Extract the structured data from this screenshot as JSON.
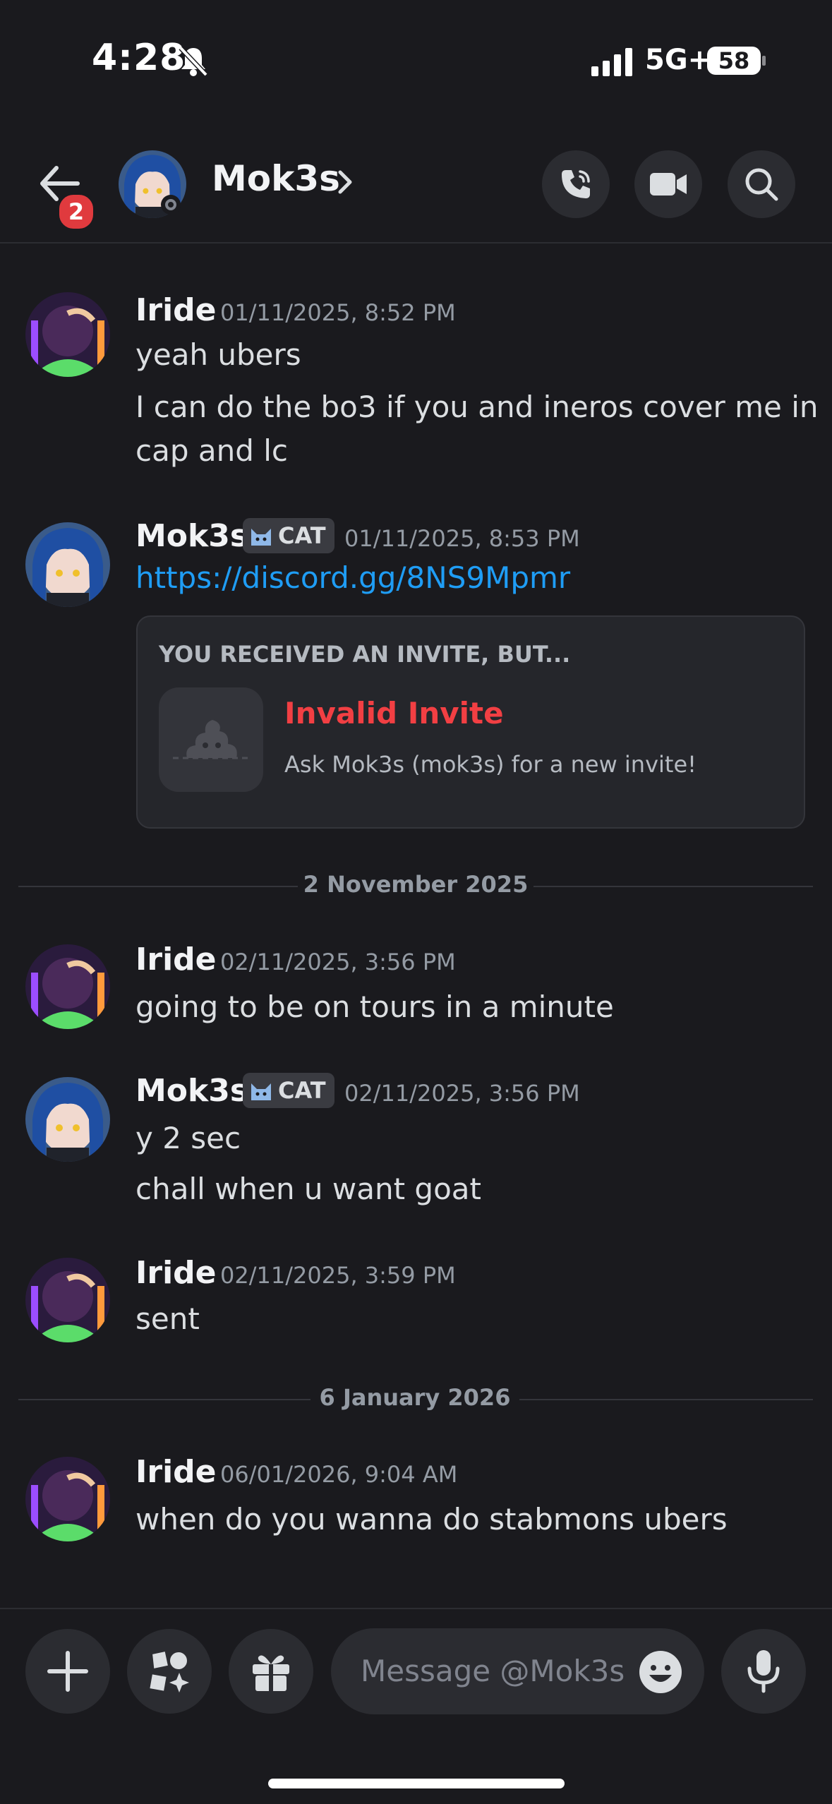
{
  "status_bar": {
    "time": "4:28",
    "network": "5G+",
    "battery": "58"
  },
  "header": {
    "badge_count": "2",
    "name": "Mok3s"
  },
  "messages": [
    {
      "user": "Iride",
      "timestamp": "01/11/2025, 8:52 PM",
      "lines": [
        "yeah ubers",
        "I can do the bo3 if you and ineros cover me in",
        "cap and lc"
      ]
    },
    {
      "user": "Mok3s",
      "tag": "CAT",
      "timestamp": "01/11/2025, 8:53 PM",
      "link": "https://discord.gg/8NS9Mpmr",
      "embed": {
        "title": "YOU RECEIVED AN INVITE, BUT...",
        "heading": "Invalid Invite",
        "subtext": "Ask Mok3s (mok3s) for a new invite!"
      }
    },
    {
      "user": "Iride",
      "timestamp": "02/11/2025, 3:56 PM",
      "lines": [
        "going to be on tours in a minute"
      ]
    },
    {
      "user": "Mok3s",
      "tag": "CAT",
      "timestamp": "02/11/2025, 3:56 PM",
      "lines": [
        "y 2 sec",
        "chall when u want goat"
      ]
    },
    {
      "user": "Iride",
      "timestamp": "02/11/2025, 3:59 PM",
      "lines": [
        "sent"
      ]
    },
    {
      "user": "Iride",
      "timestamp": "06/01/2026, 9:04 AM",
      "lines": [
        "when do you wanna do stabmons ubers"
      ]
    }
  ],
  "dividers": [
    "2 November 2025",
    "6 January 2026"
  ],
  "composer": {
    "placeholder": "Message @Mok3s"
  },
  "colors": {
    "background": "#1a1a1e",
    "link": "#1f9df5",
    "invalid": "#f23f43",
    "badge": "#e03a3e"
  }
}
